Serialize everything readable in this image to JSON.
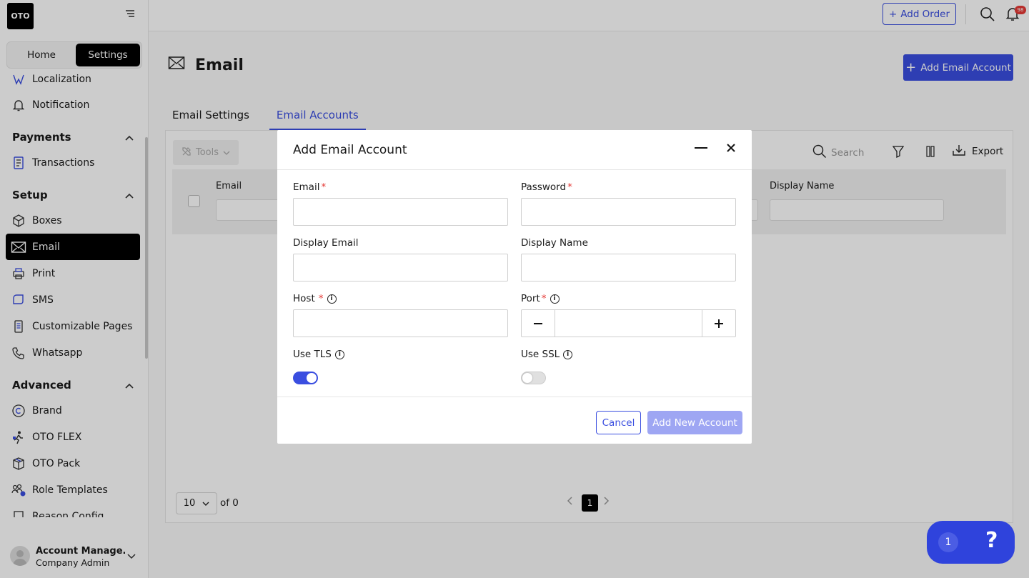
{
  "app": {
    "logo_text": "OTO"
  },
  "sidebar": {
    "segment": {
      "home": "Home",
      "settings": "Settings"
    },
    "items_top": [
      {
        "label": "Localization",
        "icon": "localization-icon"
      },
      {
        "label": "Notification",
        "icon": "bell-icon"
      }
    ],
    "sections": [
      {
        "title": "Payments",
        "items": [
          {
            "label": "Transactions",
            "icon": "transactions-icon"
          }
        ]
      },
      {
        "title": "Setup",
        "items": [
          {
            "label": "Boxes",
            "icon": "box-icon"
          },
          {
            "label": "Email",
            "icon": "mail-icon",
            "active": true
          },
          {
            "label": "Print",
            "icon": "printer-icon"
          },
          {
            "label": "SMS",
            "icon": "sms-icon"
          },
          {
            "label": "Customizable Pages",
            "icon": "pages-icon"
          },
          {
            "label": "Whatsapp",
            "icon": "phone-icon"
          }
        ]
      },
      {
        "title": "Advanced",
        "items": [
          {
            "label": "Brand",
            "icon": "copyright-icon"
          },
          {
            "label": "OTO FLEX",
            "icon": "flex-icon"
          },
          {
            "label": "OTO Pack",
            "icon": "pack-icon"
          },
          {
            "label": "Role Templates",
            "icon": "roles-icon"
          },
          {
            "label": "Reason Config",
            "icon": "reason-icon"
          }
        ]
      }
    ],
    "user": {
      "name": "Account Manage...",
      "role": "Company Admin"
    }
  },
  "topbar": {
    "add_order": "Add Order",
    "notification_count": "98"
  },
  "page": {
    "title": "Email",
    "add_button": "Add Email Account",
    "tabs": [
      {
        "label": "Email Settings"
      },
      {
        "label": "Email Accounts",
        "active": true
      }
    ]
  },
  "table": {
    "tools": "Tools",
    "search_placeholder": "Search",
    "export": "Export",
    "columns": [
      "Email",
      "Display Name"
    ],
    "page_size": "10",
    "of_text": "of 0",
    "current_page": "1"
  },
  "modal": {
    "title": "Add Email Account",
    "fields": {
      "email": {
        "label": "Email",
        "required": "*",
        "value": ""
      },
      "password": {
        "label": "Password",
        "required": "*",
        "value": ""
      },
      "display_email": {
        "label": "Display Email",
        "value": ""
      },
      "display_name": {
        "label": "Display Name",
        "value": ""
      },
      "host": {
        "label": "Host",
        "required": "*",
        "value": ""
      },
      "port": {
        "label": "Port",
        "required": "*",
        "value": ""
      },
      "use_tls": {
        "label": "Use TLS",
        "on": true
      },
      "use_ssl": {
        "label": "Use SSL",
        "on": false
      }
    },
    "cancel": "Cancel",
    "submit": "Add New Account"
  },
  "help_widget": {
    "count": "1",
    "symbol": "?"
  },
  "colors": {
    "accent": "#3a4ee0",
    "disabled_accent": "#9ea6f3",
    "required": "#e53935"
  }
}
